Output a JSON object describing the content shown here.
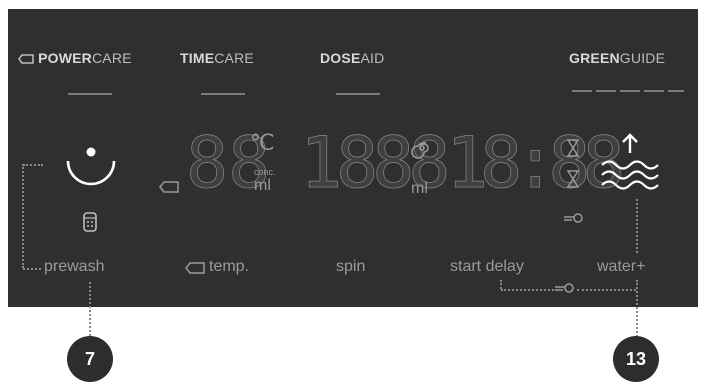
{
  "headers": {
    "powercare_bold": "POWER",
    "powercare_rest": "CARE",
    "timecare_bold": "TIME",
    "timecare_rest": "CARE",
    "doseaid_bold": "DOSE",
    "doseaid_rest": "AID",
    "greenguide_bold": "GREEN",
    "greenguide_rest": "GUIDE"
  },
  "display": {
    "temp_digits": "88",
    "temp_unit": "℃",
    "conc_label": "conc.",
    "ml_label": "ml",
    "spin_digits": "1888",
    "spin_ml": "ml",
    "time_digits": "18:88"
  },
  "labels": {
    "prewash": "prewash",
    "temp": "temp.",
    "spin": "spin",
    "start_delay": "start delay",
    "water_plus": "water+"
  },
  "callouts": {
    "left": "7",
    "right": "13"
  },
  "icons": [
    "tag-icon",
    "prewash-knob-icon",
    "detergent-icon",
    "spiral-icon",
    "hourglass-icon",
    "key-icon",
    "water-up-icon"
  ]
}
